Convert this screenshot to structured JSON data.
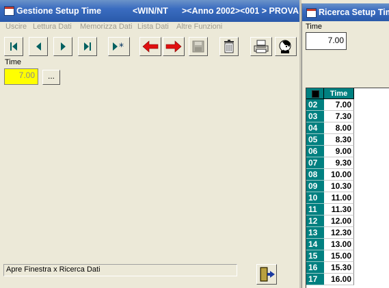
{
  "main_window": {
    "title": "Gestione Setup Time",
    "title_seg2": "<WIN/NT",
    "title_seg3": "><Anno 2002><001 > PROVA",
    "menu": [
      "Uscire",
      "Lettura Dati",
      "Memorizza Dati",
      "Lista Dati",
      "Altre Funzioni"
    ],
    "toolbar_icons": [
      "first-record-icon",
      "previous-record-icon",
      "next-record-icon",
      "last-record-icon",
      "new-record-icon",
      "undo-icon",
      "redo-icon",
      "save-icon",
      "delete-icon",
      "print-icon",
      "help-icon"
    ],
    "time_label": "Time",
    "time_value": "7.00",
    "browse_label": "...",
    "status_text": "Apre Finestra x Ricerca Dati",
    "exit_icon": "exit-door-icon"
  },
  "search_window": {
    "title": "Ricerca Setup Time",
    "time_label": "Time",
    "time_value": "7.00",
    "grid": {
      "column_header": "Time",
      "rows": [
        {
          "id": "02",
          "time": "7.00"
        },
        {
          "id": "03",
          "time": "7.30"
        },
        {
          "id": "04",
          "time": "8.00"
        },
        {
          "id": "05",
          "time": "8.30"
        },
        {
          "id": "06",
          "time": "9.00"
        },
        {
          "id": "07",
          "time": "9.30"
        },
        {
          "id": "08",
          "time": "10.00"
        },
        {
          "id": "09",
          "time": "10.30"
        },
        {
          "id": "10",
          "time": "11.00"
        },
        {
          "id": "11",
          "time": "11.30"
        },
        {
          "id": "12",
          "time": "12.00"
        },
        {
          "id": "13",
          "time": "12.30"
        },
        {
          "id": "14",
          "time": "13.00"
        },
        {
          "id": "15",
          "time": "15.00"
        },
        {
          "id": "16",
          "time": "15.30"
        },
        {
          "id": "17",
          "time": "16.00"
        }
      ]
    }
  },
  "colors": {
    "title_bar": "#2a5aaa",
    "grid_header": "#008080",
    "field_highlight": "#ffff00"
  }
}
